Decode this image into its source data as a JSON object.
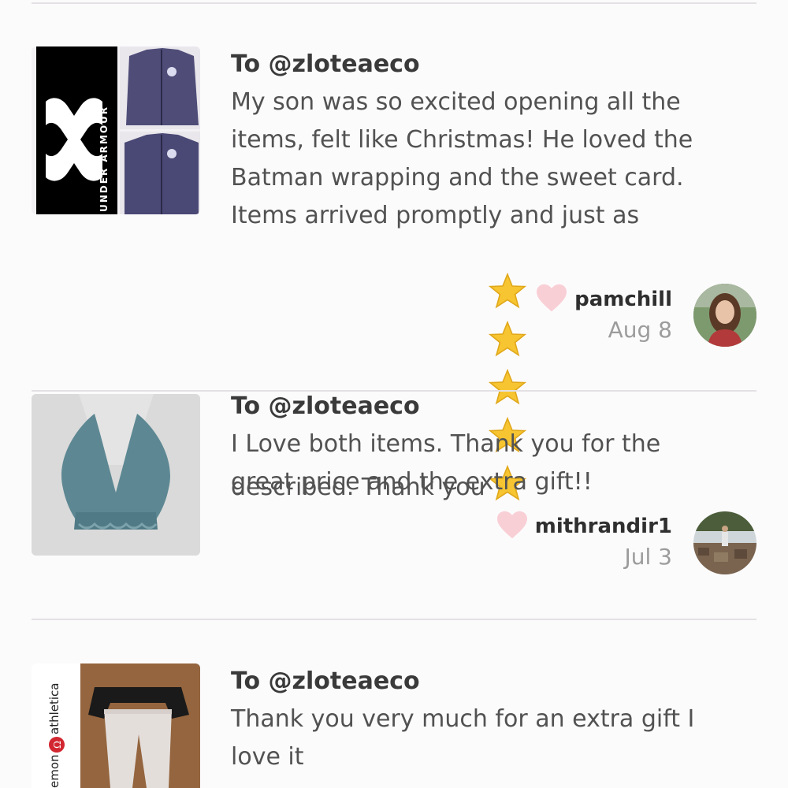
{
  "reviews": [
    {
      "to": "To @zloteaeco",
      "body": "My son was so excited opening all the\nitems, felt like Christmas! He loved the\nBatman wrapping and the sweet card.\nItems arrived promptly and just as\ndescribed. Thank you",
      "stars": 5,
      "author": "pamchill",
      "date": "Aug 8",
      "thumb_brand": "UNDER ARMOUR",
      "thumb_icon": "under-armour-logo"
    },
    {
      "to": "To @zloteaeco",
      "body": "I Love both items. Thank you for the\ngreat price and the extra gift!!",
      "author": "mithrandir1",
      "date": "Jul 3",
      "thumb_icon": "lace-bralette"
    },
    {
      "to": "To @zloteaeco",
      "body": "Thank you very much for an extra gift I\nlove it",
      "thumb_brand": "lululemon athletica",
      "thumb_brand_visible": "emon athletica",
      "thumb_icon": "lululemon-logo"
    }
  ],
  "colors": {
    "background": "#fcfbfc",
    "divider": "#e4e1e4",
    "heart": "#f9cfd6",
    "star": "#f7c531",
    "text": "#525252",
    "date": "#9c9c9c"
  }
}
